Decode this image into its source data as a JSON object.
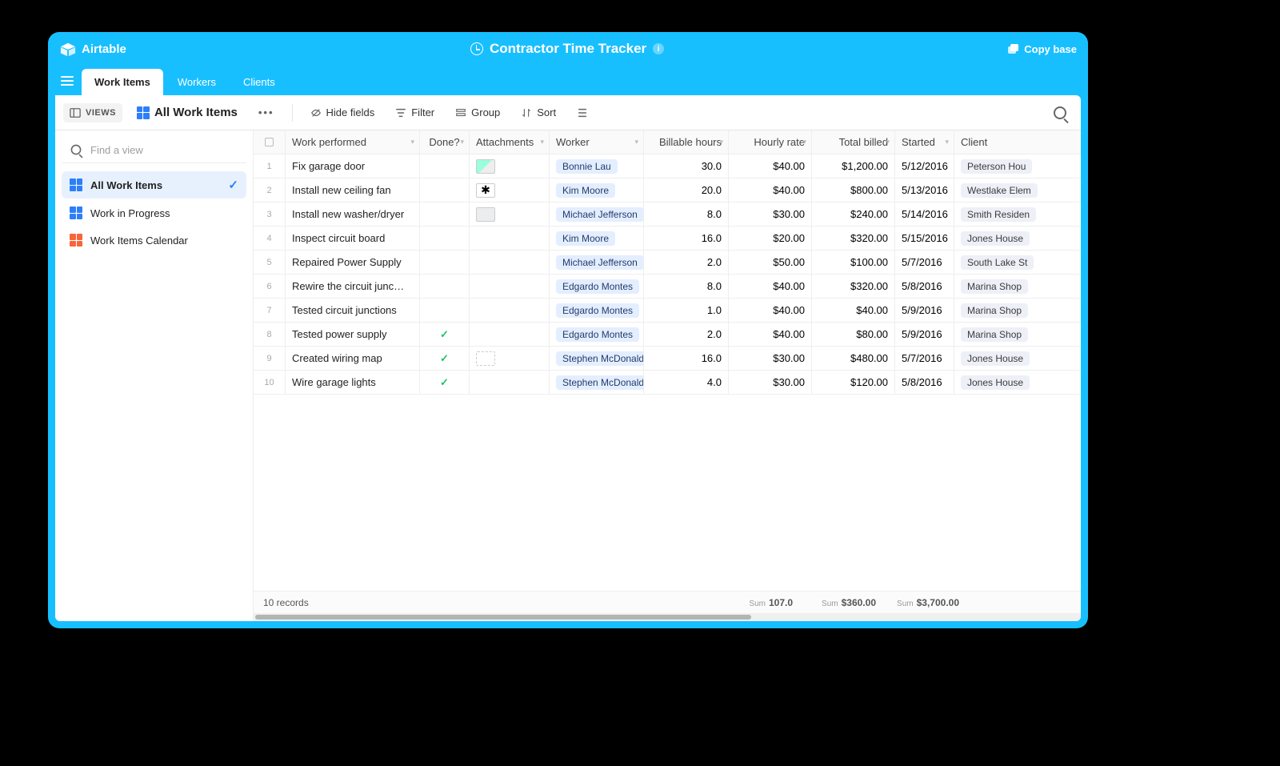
{
  "brand": "Airtable",
  "base_title": "Contractor Time Tracker",
  "copy_base": "Copy base",
  "tabs": [
    "Work Items",
    "Workers",
    "Clients"
  ],
  "toolbar": {
    "views": "VIEWS",
    "view_name": "All Work Items",
    "hide_fields": "Hide fields",
    "filter": "Filter",
    "group": "Group",
    "sort": "Sort"
  },
  "sidebar": {
    "find_placeholder": "Find a view",
    "items": [
      {
        "label": "All Work Items",
        "type": "grid",
        "active": true
      },
      {
        "label": "Work in Progress",
        "type": "grid",
        "active": false
      },
      {
        "label": "Work Items Calendar",
        "type": "calendar",
        "active": false
      }
    ]
  },
  "columns": [
    "Work performed",
    "Done?",
    "Attachments",
    "Worker",
    "Billable hours",
    "Hourly rate",
    "Total billed",
    "Started",
    "Client"
  ],
  "rows": [
    {
      "n": 1,
      "work": "Fix garage door",
      "done": false,
      "att": "photo",
      "worker": "Bonnie Lau",
      "hours": "30.0",
      "rate": "$40.00",
      "billed": "$1,200.00",
      "started": "5/12/2016",
      "client": "Peterson Hou"
    },
    {
      "n": 2,
      "work": "Install new ceiling fan",
      "done": false,
      "att": "fan",
      "worker": "Kim Moore",
      "hours": "20.0",
      "rate": "$40.00",
      "billed": "$800.00",
      "started": "5/13/2016",
      "client": "Westlake Elem"
    },
    {
      "n": 3,
      "work": "Install new washer/dryer",
      "done": false,
      "att": "washer",
      "worker": "Michael Jefferson",
      "hours": "8.0",
      "rate": "$30.00",
      "billed": "$240.00",
      "started": "5/14/2016",
      "client": "Smith Residen"
    },
    {
      "n": 4,
      "work": "Inspect circuit board",
      "done": false,
      "att": "",
      "worker": "Kim Moore",
      "hours": "16.0",
      "rate": "$20.00",
      "billed": "$320.00",
      "started": "5/15/2016",
      "client": "Jones House"
    },
    {
      "n": 5,
      "work": "Repaired Power Supply",
      "done": false,
      "att": "",
      "worker": "Michael Jefferson",
      "hours": "2.0",
      "rate": "$50.00",
      "billed": "$100.00",
      "started": "5/7/2016",
      "client": "South Lake St"
    },
    {
      "n": 6,
      "work": "Rewire the circuit junc…",
      "done": false,
      "att": "",
      "worker": "Edgardo Montes",
      "hours": "8.0",
      "rate": "$40.00",
      "billed": "$320.00",
      "started": "5/8/2016",
      "client": "Marina Shop"
    },
    {
      "n": 7,
      "work": "Tested circuit junctions",
      "done": false,
      "att": "",
      "worker": "Edgardo Montes",
      "hours": "1.0",
      "rate": "$40.00",
      "billed": "$40.00",
      "started": "5/9/2016",
      "client": "Marina Shop"
    },
    {
      "n": 8,
      "work": "Tested power supply",
      "done": true,
      "att": "",
      "worker": "Edgardo Montes",
      "hours": "2.0",
      "rate": "$40.00",
      "billed": "$80.00",
      "started": "5/9/2016",
      "client": "Marina Shop"
    },
    {
      "n": 9,
      "work": "Created wiring map",
      "done": true,
      "att": "map",
      "worker": "Stephen McDonald",
      "hours": "16.0",
      "rate": "$30.00",
      "billed": "$480.00",
      "started": "5/7/2016",
      "client": "Jones House"
    },
    {
      "n": 10,
      "work": "Wire garage lights",
      "done": true,
      "att": "",
      "worker": "Stephen McDonald",
      "hours": "4.0",
      "rate": "$30.00",
      "billed": "$120.00",
      "started": "5/8/2016",
      "client": "Jones House"
    }
  ],
  "footer": {
    "records": "10 records",
    "sum_hours": "107.0",
    "sum_rate": "$360.00",
    "sum_billed": "$3,700.00",
    "sum_label": "Sum"
  }
}
